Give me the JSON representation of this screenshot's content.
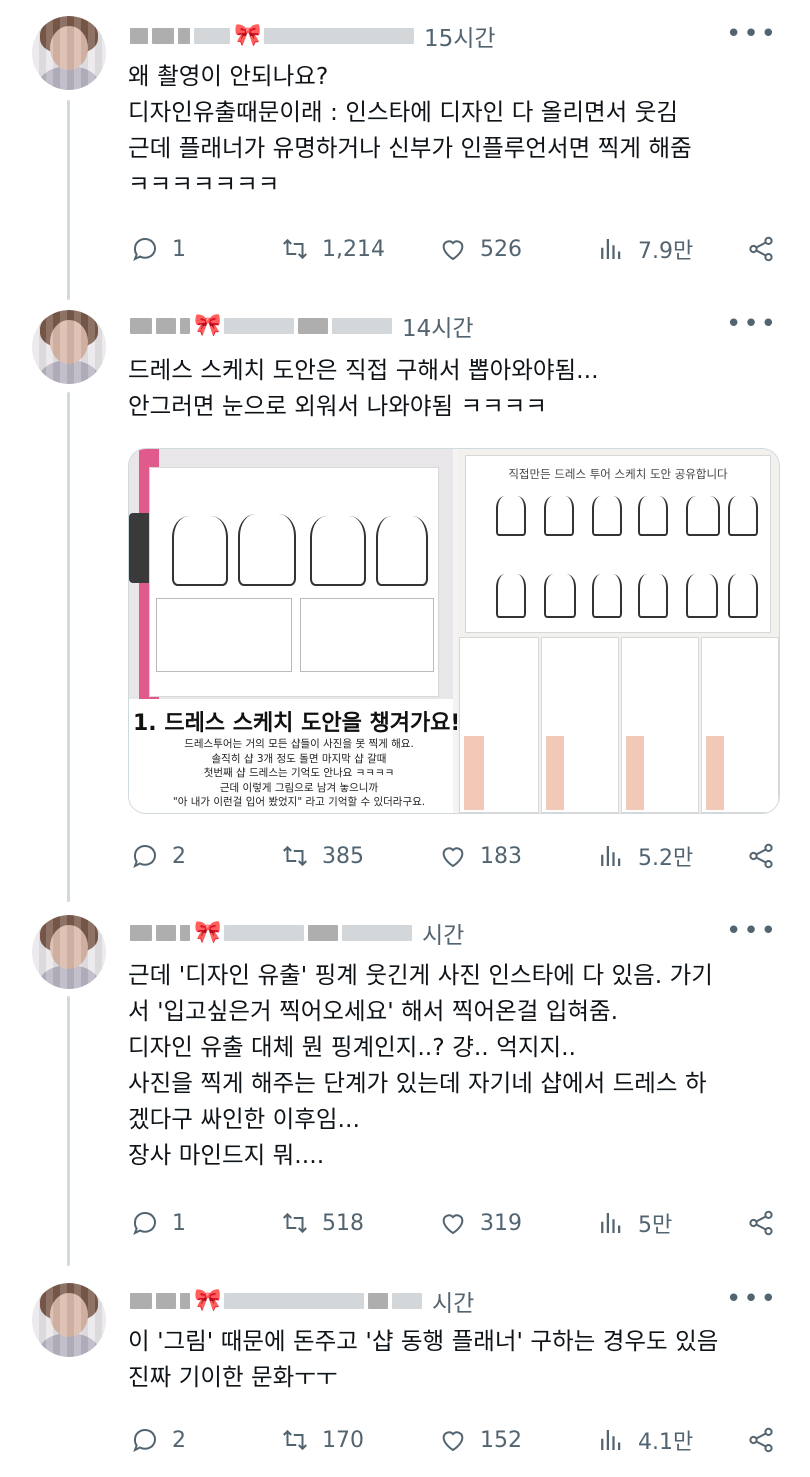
{
  "tweets": [
    {
      "time": "15시간",
      "text": "왜 촬영이 안되나요?\n디자인유출때문이래 : 인스타에 디자인 다 올리면서 웃김\n근데 플래너가 유명하거나 신부가 인플루언서면 찍게 해줌\nㅋㅋㅋㅋㅋㅋㅋ",
      "replies": "1",
      "retweets": "1,214",
      "likes": "526",
      "views": "7.9만"
    },
    {
      "time": "14시간",
      "text": "드레스 스케치 도안은 직접 구해서 뽑아와야됨...\n안그러면 눈으로 외워서 나와야됨 ㅋㅋㅋㅋ",
      "replies": "2",
      "retweets": "385",
      "likes": "183",
      "views": "5.2만",
      "media": {
        "left_caption_title": "1. 드레스 스케치 도안을 챙겨가요!",
        "left_caption_lines": "드레스투어는 거의 모든 샵들이 사진을 못 찍게 해요.\n솔직히 샵 3개 정도 돌면 마지막 샵 갈때\n첫번째 샵 드레스는 기억도 안나요 ㅋㅋㅋㅋ\n근데 이렇게 그림으로 남겨 놓으니까\n\"아 내가 이런걸 입어 봤었지\" 라고 기억할 수 있더라구요.",
        "right_sheet_title": "직접만든 드레스 투어 스케치 도안 공유합니다"
      }
    },
    {
      "time": "시간",
      "text": "근데 '디자인 유출' 핑계 웃긴게 사진 인스타에 다 있음. 가기\n서 '입고싶은거 찍어오세요' 해서 찍어온걸 입혀줌.\n디자인 유출 대체 뭔 핑계인지..? 걍.. 억지지..\n사진을 찍게 해주는 단계가 있는데 자기네 샵에서 드레스 하\n겠다구 싸인한 이후임...\n장사 마인드지 뭐....",
      "replies": "1",
      "retweets": "518",
      "likes": "319",
      "views": "5만"
    },
    {
      "time": "시간",
      "text": "이 '그림' 때문에 돈주고 '샵 동행 플래너' 구하는 경우도 있음\n진짜 기이한 문화ㅜㅜ",
      "replies": "2",
      "retweets": "170",
      "likes": "152",
      "views": "4.1만"
    }
  ],
  "icons": {
    "reply": "reply-icon",
    "retweet": "retweet-icon",
    "like": "heart-icon",
    "views": "views-icon",
    "share": "share-icon",
    "more": "more-icon",
    "ribbon": "ribbon-icon"
  },
  "colors": {
    "text": "#0f1419",
    "muted": "#536471",
    "line": "#cfd9de",
    "ribbon": "#e0245e"
  }
}
